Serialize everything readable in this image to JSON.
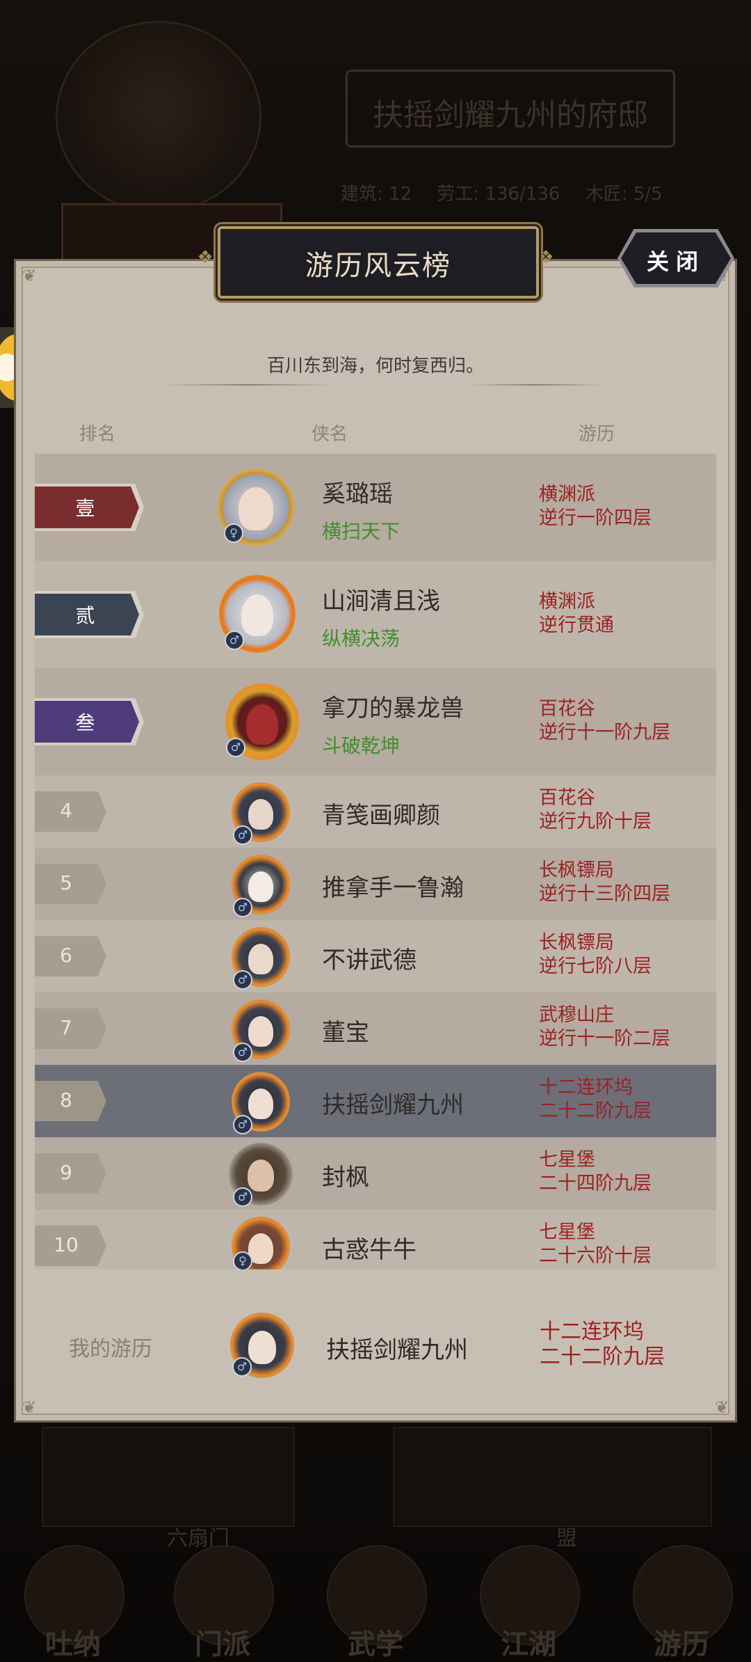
{
  "background": {
    "estate_title": "扶摇剑耀九州的府邸",
    "stats": [
      "建筑: 12",
      "劳工: 136/136",
      "木匠: 5/5"
    ],
    "buildings": [
      "六扇门",
      "盟"
    ],
    "nav": [
      "吐纳",
      "门派",
      "武学",
      "江湖",
      "游历"
    ]
  },
  "modal": {
    "title": "游历风云榜",
    "close_label": "关闭",
    "subtitle": "百川东到海，何时复西归。",
    "columns": {
      "rank": "排名",
      "name": "侠名",
      "travel": "游历"
    },
    "top3": [
      {
        "rank": "壹",
        "name": "奚璐瑶",
        "title": "横扫天下",
        "sect": "横渊派",
        "progress": "逆行一阶四层",
        "gender": "♀"
      },
      {
        "rank": "贰",
        "name": "山涧清且浅",
        "title": "纵横决荡",
        "sect": "横渊派",
        "progress": "逆行贯通",
        "gender": "♂"
      },
      {
        "rank": "叁",
        "name": "拿刀的暴龙兽",
        "title": "斗破乾坤",
        "sect": "百花谷",
        "progress": "逆行十一阶九层",
        "gender": "♂"
      }
    ],
    "rows": [
      {
        "rank": "4",
        "name": "青笺画卿颜",
        "sect": "百花谷",
        "progress": "逆行九阶十层",
        "gender": "♂"
      },
      {
        "rank": "5",
        "name": "推拿手一鲁瀚",
        "sect": "长枫镖局",
        "progress": "逆行十三阶四层",
        "gender": "♂"
      },
      {
        "rank": "6",
        "name": "不讲武德",
        "sect": "长枫镖局",
        "progress": "逆行七阶八层",
        "gender": "♂"
      },
      {
        "rank": "7",
        "name": "董宝",
        "sect": "武穆山庄",
        "progress": "逆行十一阶二层",
        "gender": "♂"
      },
      {
        "rank": "8",
        "name": "扶摇剑耀九州",
        "sect": "十二连环坞",
        "progress": "二十二阶九层",
        "gender": "♂"
      },
      {
        "rank": "9",
        "name": "封枫",
        "sect": "七星堡",
        "progress": "二十四阶九层",
        "gender": "♂"
      },
      {
        "rank": "10",
        "name": "古惑牛牛",
        "sect": "七星堡",
        "progress": "二十六阶十层",
        "gender": "♀"
      }
    ],
    "mine": {
      "label": "我的游历",
      "name": "扶摇剑耀九州",
      "sect": "十二连环坞",
      "progress": "二十二阶九层",
      "gender": "♂"
    }
  },
  "colors": {
    "rank1": "#7a2d2f",
    "rank2": "#3a4452",
    "rank3": "#4d3c79",
    "sect_text": "#9b2222",
    "title_text": "#3f8f2b",
    "self_row": "#6c6e78"
  }
}
